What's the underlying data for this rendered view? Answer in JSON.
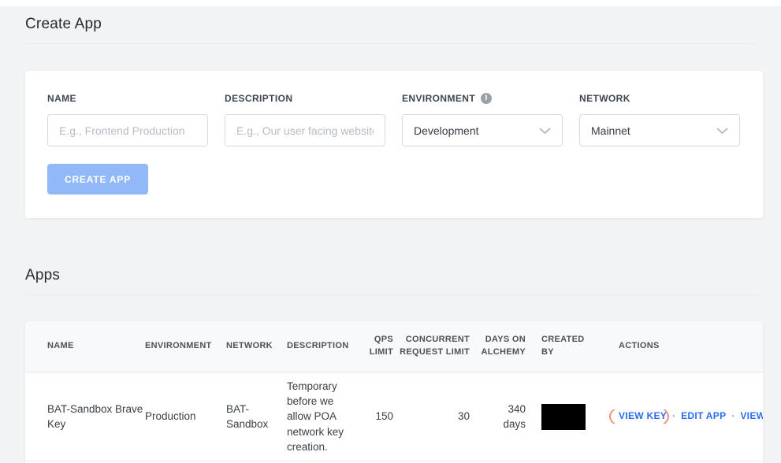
{
  "page": {
    "create_app_title": "Create App",
    "apps_title": "Apps"
  },
  "form": {
    "name": {
      "label": "NAME",
      "placeholder": "E.g., Frontend Production"
    },
    "description": {
      "label": "DESCRIPTION",
      "placeholder": "E.g., Our user facing website"
    },
    "environment": {
      "label": "ENVIRONMENT",
      "value": "Development"
    },
    "network": {
      "label": "NETWORK",
      "value": "Mainnet"
    },
    "submit_label": "CREATE APP"
  },
  "icons": {
    "info_icon_glyph": "i",
    "dot_separator": "·"
  },
  "table": {
    "headers": {
      "name": "NAME",
      "environment": "ENVIRONMENT",
      "network": "NETWORK",
      "description": "DESCRIPTION",
      "qps_limit": "QPS LIMIT",
      "concurrent_request_limit": "CONCURRENT REQUEST LIMIT",
      "days_on_alchemy": "DAYS ON ALCHEMY",
      "created_by": "CREATED BY",
      "actions": "ACTIONS"
    },
    "rows": [
      {
        "name": "BAT-Sandbox Brave Key",
        "environment": "Production",
        "network": "BAT-Sandbox",
        "description": "Temporary before we allow POA network key creation.",
        "qps_limit": "150",
        "concurrent_request_limit": "30",
        "days_on_alchemy": "340 days",
        "created_by_redacted": true,
        "actions": {
          "view_key": "VIEW KEY",
          "edit_app": "EDIT APP",
          "view_details": "VIEW DETAILS"
        }
      }
    ]
  },
  "colors": {
    "page_background": "#f2f3f5",
    "button_blue": "#91b9f7",
    "link_blue": "#2c6cf4",
    "highlight_ellipse": "#f0907c",
    "redaction": "#000000"
  }
}
